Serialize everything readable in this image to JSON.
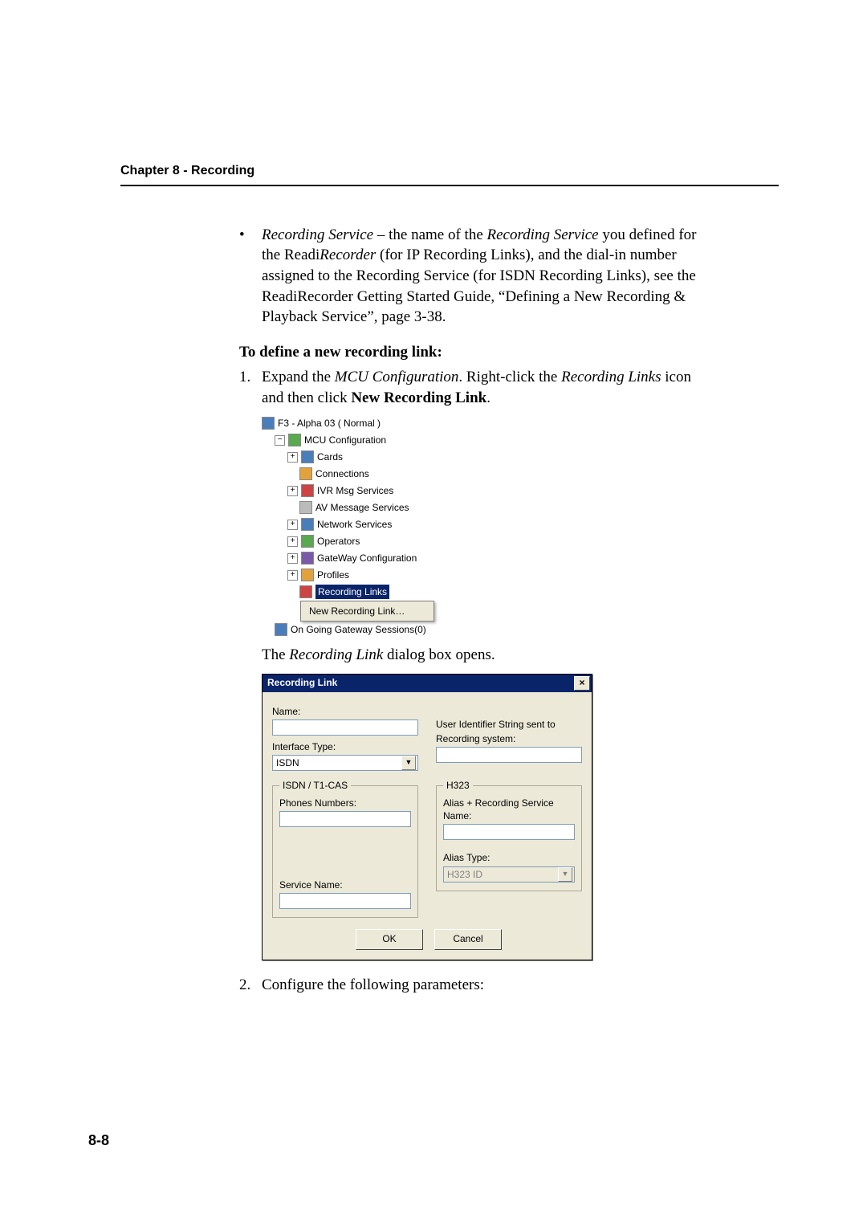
{
  "header": {
    "chapter_label": "Chapter 8 - Recording"
  },
  "bullet": {
    "term": "Recording Service",
    "dash": " – the name of the ",
    "term2": "Recording Service",
    "after_term2": " you defined for the Readi",
    "recorder_italic": "Recorder",
    "rest": " (for IP Recording Links), and the dial-in number assigned to the Recording Service (for ISDN Recording Links), see the ReadiRecorder Getting Started Guide, “Defining a New Recording & Playback Service”, page 3-38."
  },
  "section": {
    "define_heading": "To define a new recording link:"
  },
  "step1": {
    "lead": "Expand the ",
    "mcu_conf": "MCU Configuration",
    "mid": ". Right-click the ",
    "rec_links": "Recording Links",
    "after": " icon and then click ",
    "new_link_bold": "New Recording Link",
    "period": "."
  },
  "tree": {
    "root": "F3 - Alpha 03 ( Normal )",
    "mcu": "MCU Configuration",
    "cards": "Cards",
    "connections": "Connections",
    "ivr": "IVR Msg Services",
    "av": "AV Message Services",
    "network": "Network Services",
    "operators": "Operators",
    "gateway": "GateWay Configuration",
    "profiles": "Profiles",
    "recording_links": "Recording Links",
    "new_recording_link": "New Recording Link…",
    "ongoing": "On Going Gateway Sessions(0)"
  },
  "caption": {
    "pre": "The ",
    "italic": "Recording Link",
    "post": " dialog box opens."
  },
  "dialog": {
    "title": "Recording Link",
    "close": "×",
    "name_label": "Name:",
    "name_value": "",
    "interface_label": "Interface Type:",
    "interface_value": "ISDN",
    "user_id_label1": "User Identifier String sent to",
    "user_id_label2": "Recording system:",
    "user_id_value": "",
    "isdn": {
      "legend": "ISDN / T1-CAS",
      "phones_label": "Phones  Numbers:",
      "phones_value": "",
      "service_label": "Service Name:",
      "service_value": ""
    },
    "h323": {
      "legend": "H323",
      "alias_service_label": "Alias + Recording Service Name:",
      "alias_service_value": "",
      "alias_type_label": "Alias Type:",
      "alias_type_value": "H323 ID"
    },
    "ok": "OK",
    "cancel": "Cancel"
  },
  "step2": {
    "text": "Configure the following parameters:"
  },
  "page_number": "8-8"
}
